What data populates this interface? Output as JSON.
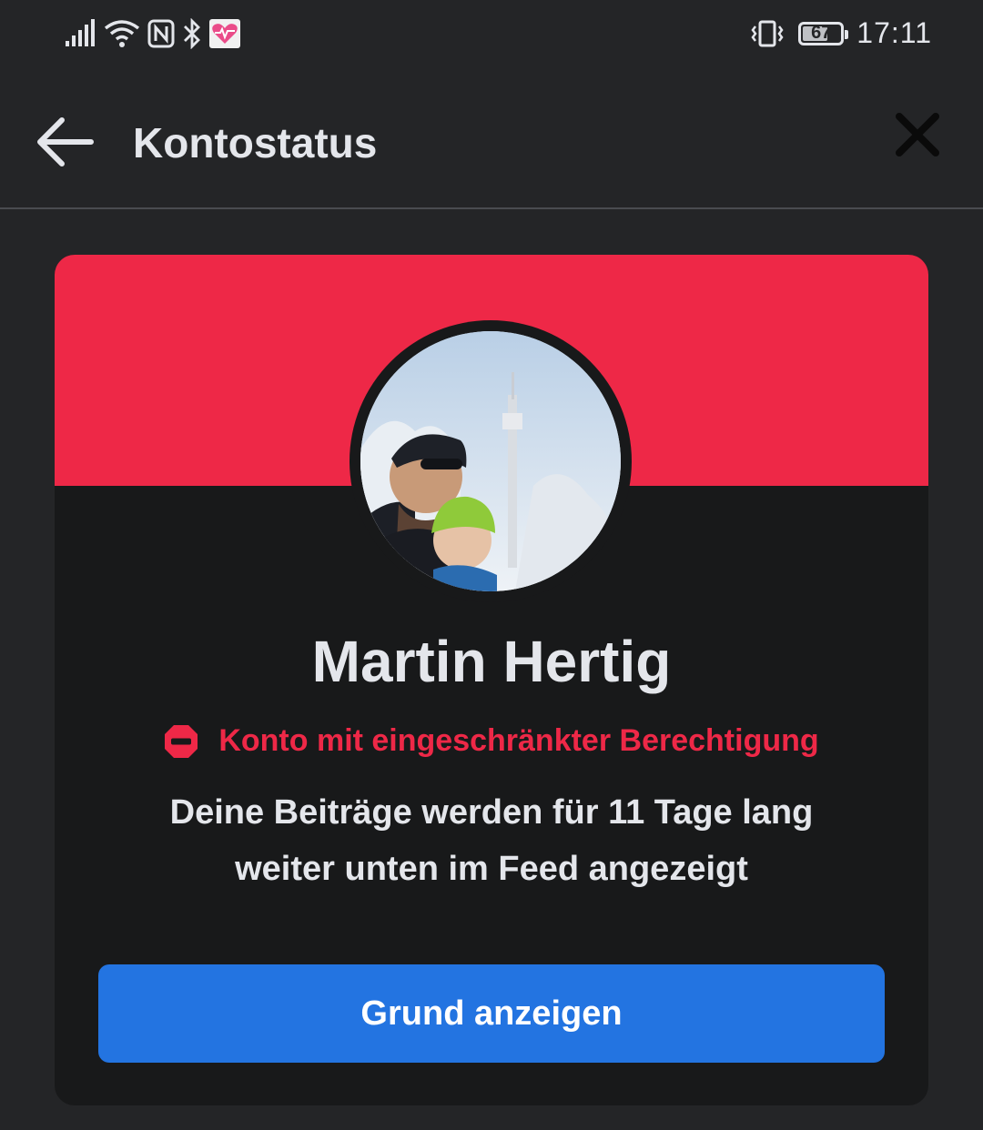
{
  "status_bar": {
    "time": "17:11",
    "battery_level": "67",
    "battery_fraction": 0.67,
    "icons": [
      "signal-icon",
      "wifi-icon",
      "nfc-icon",
      "bluetooth-icon",
      "health-icon",
      "vibrate-icon",
      "battery-icon"
    ]
  },
  "header": {
    "title": "Kontostatus",
    "back_icon": "arrow-left-icon",
    "close_icon": "close-icon"
  },
  "card": {
    "banner_color": "#ee2847",
    "name": "Martin Hertig",
    "status_icon": "restricted-icon",
    "status_text": "Konto mit eingeschränkter Berechtigung",
    "description": "Deine Beiträge werden für 11 Tage lang weiter unten im Feed angezeigt",
    "button_label": "Grund anzeigen",
    "button_color": "#2374e1"
  }
}
